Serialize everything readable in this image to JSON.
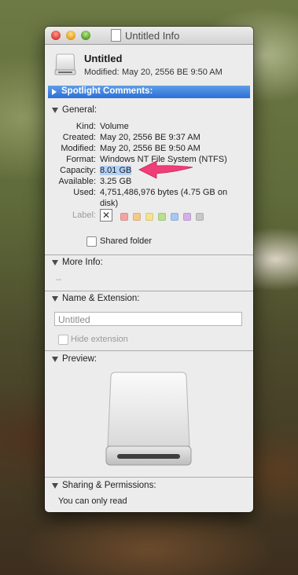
{
  "window": {
    "title": "Untitled Info"
  },
  "header": {
    "name": "Untitled",
    "modified_label": "Modified:",
    "modified_value": "May 20, 2556 BE 9:50 AM"
  },
  "spotlight": {
    "label": "Spotlight Comments:"
  },
  "general": {
    "label": "General:",
    "kind_label": "Kind:",
    "kind_value": "Volume",
    "created_label": "Created:",
    "created_value": "May 20, 2556 BE 9:37 AM",
    "modified_label": "Modified:",
    "modified_value": "May 20, 2556 BE 9:50 AM",
    "format_label": "Format:",
    "format_value": "Windows NT File System (NTFS)",
    "capacity_label": "Capacity:",
    "capacity_value": "8.01 GB",
    "available_label": "Available:",
    "available_value": "3.25 GB",
    "used_label": "Used:",
    "used_value_line1": "4,751,486,976 bytes (4.75 GB on",
    "used_value_line2": "disk)",
    "label_label": "Label:",
    "label_colors": [
      "#f4a3a3",
      "#f6c98a",
      "#f4e38c",
      "#b8e08e",
      "#a6c8f2",
      "#d4b0e8",
      "#c8c8c8"
    ],
    "shared_folder_label": "Shared folder"
  },
  "more_info": {
    "label": "More Info:",
    "value": "--"
  },
  "name_ext": {
    "label": "Name & Extension:",
    "name_value": "Untitled",
    "hide_extension_label": "Hide extension"
  },
  "preview": {
    "label": "Preview:"
  },
  "sharing": {
    "label": "Sharing & Permissions:",
    "status": "You can only read"
  },
  "accent": {
    "selection": "#2a6fd6",
    "arrow": "#ef3f78"
  }
}
